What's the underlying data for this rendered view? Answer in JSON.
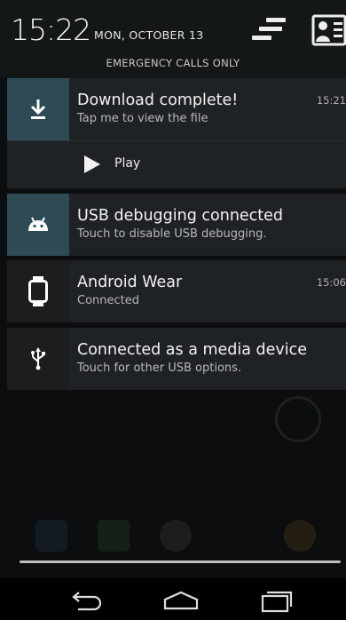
{
  "status": {
    "time": "15:22",
    "date": "MON, OCTOBER 13",
    "carrier_notice": "EMERGENCY CALLS ONLY"
  },
  "notifications": [
    {
      "title": "Download complete!",
      "subtitle": "Tap me to view the file",
      "time": "15:21",
      "icon": "download-icon",
      "icon_bg": "#2d4a55",
      "action": {
        "label": "Play",
        "icon": "play-icon"
      }
    },
    {
      "title": "USB debugging connected",
      "subtitle": "Touch to disable USB debugging.",
      "time": "",
      "icon": "android-icon",
      "icon_bg": "#2d4a55"
    },
    {
      "title": "Android Wear",
      "subtitle": "Connected",
      "time": "15:06",
      "icon": "watch-icon",
      "icon_bg": "#1b1d1f"
    },
    {
      "title": "Connected as a media device",
      "subtitle": "Touch for other USB options.",
      "time": "",
      "icon": "usb-icon",
      "icon_bg": "#1b1d1f"
    }
  ],
  "navbar": {
    "buttons": [
      "back-icon",
      "home-icon",
      "recents-icon"
    ]
  }
}
